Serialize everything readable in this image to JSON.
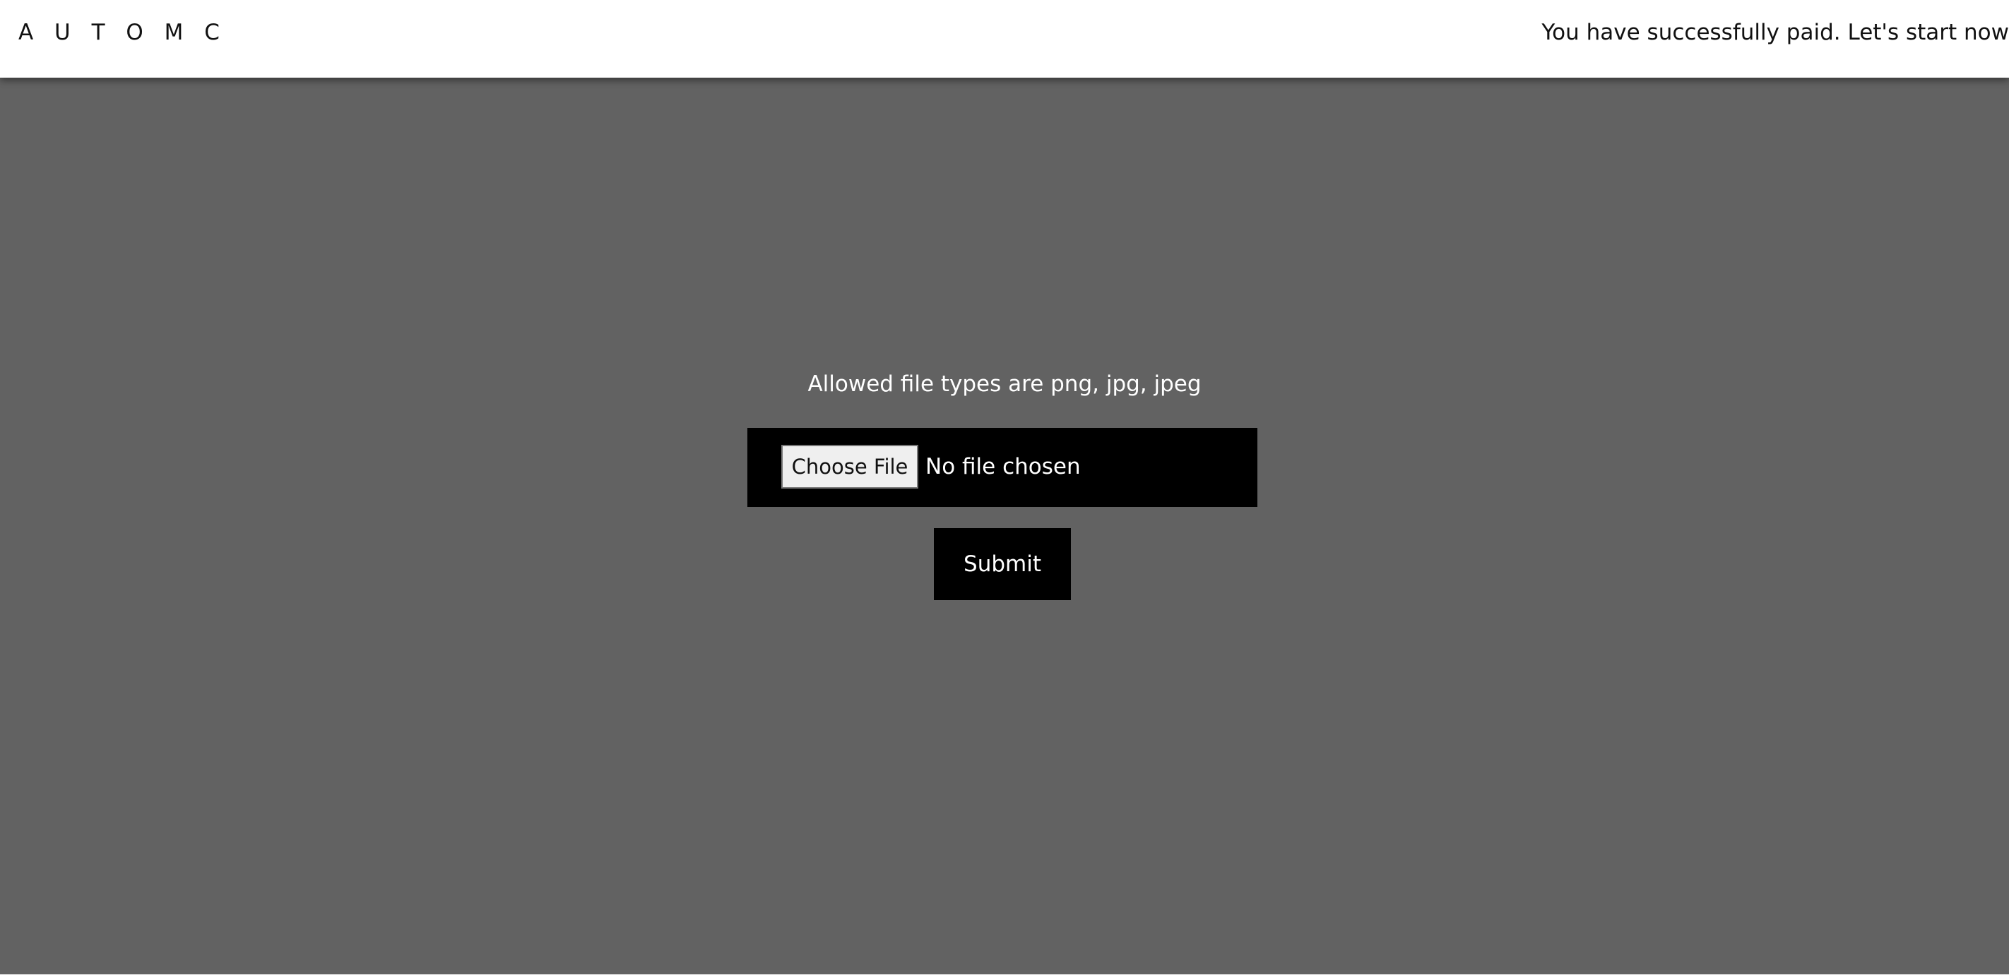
{
  "header": {
    "brand": "A U T O M C",
    "notice": "You have successfully paid. Let's start now"
  },
  "upload": {
    "allowed_types_text": "Allowed file types are png, jpg, jpeg",
    "choose_file_label": "Choose File",
    "file_status": "No file chosen",
    "submit_label": "Submit"
  },
  "colors": {
    "page_background": "#626262",
    "header_background": "#ffffff",
    "panel_background": "#000000",
    "text_light": "#ffffff",
    "text_dark": "#111111"
  }
}
